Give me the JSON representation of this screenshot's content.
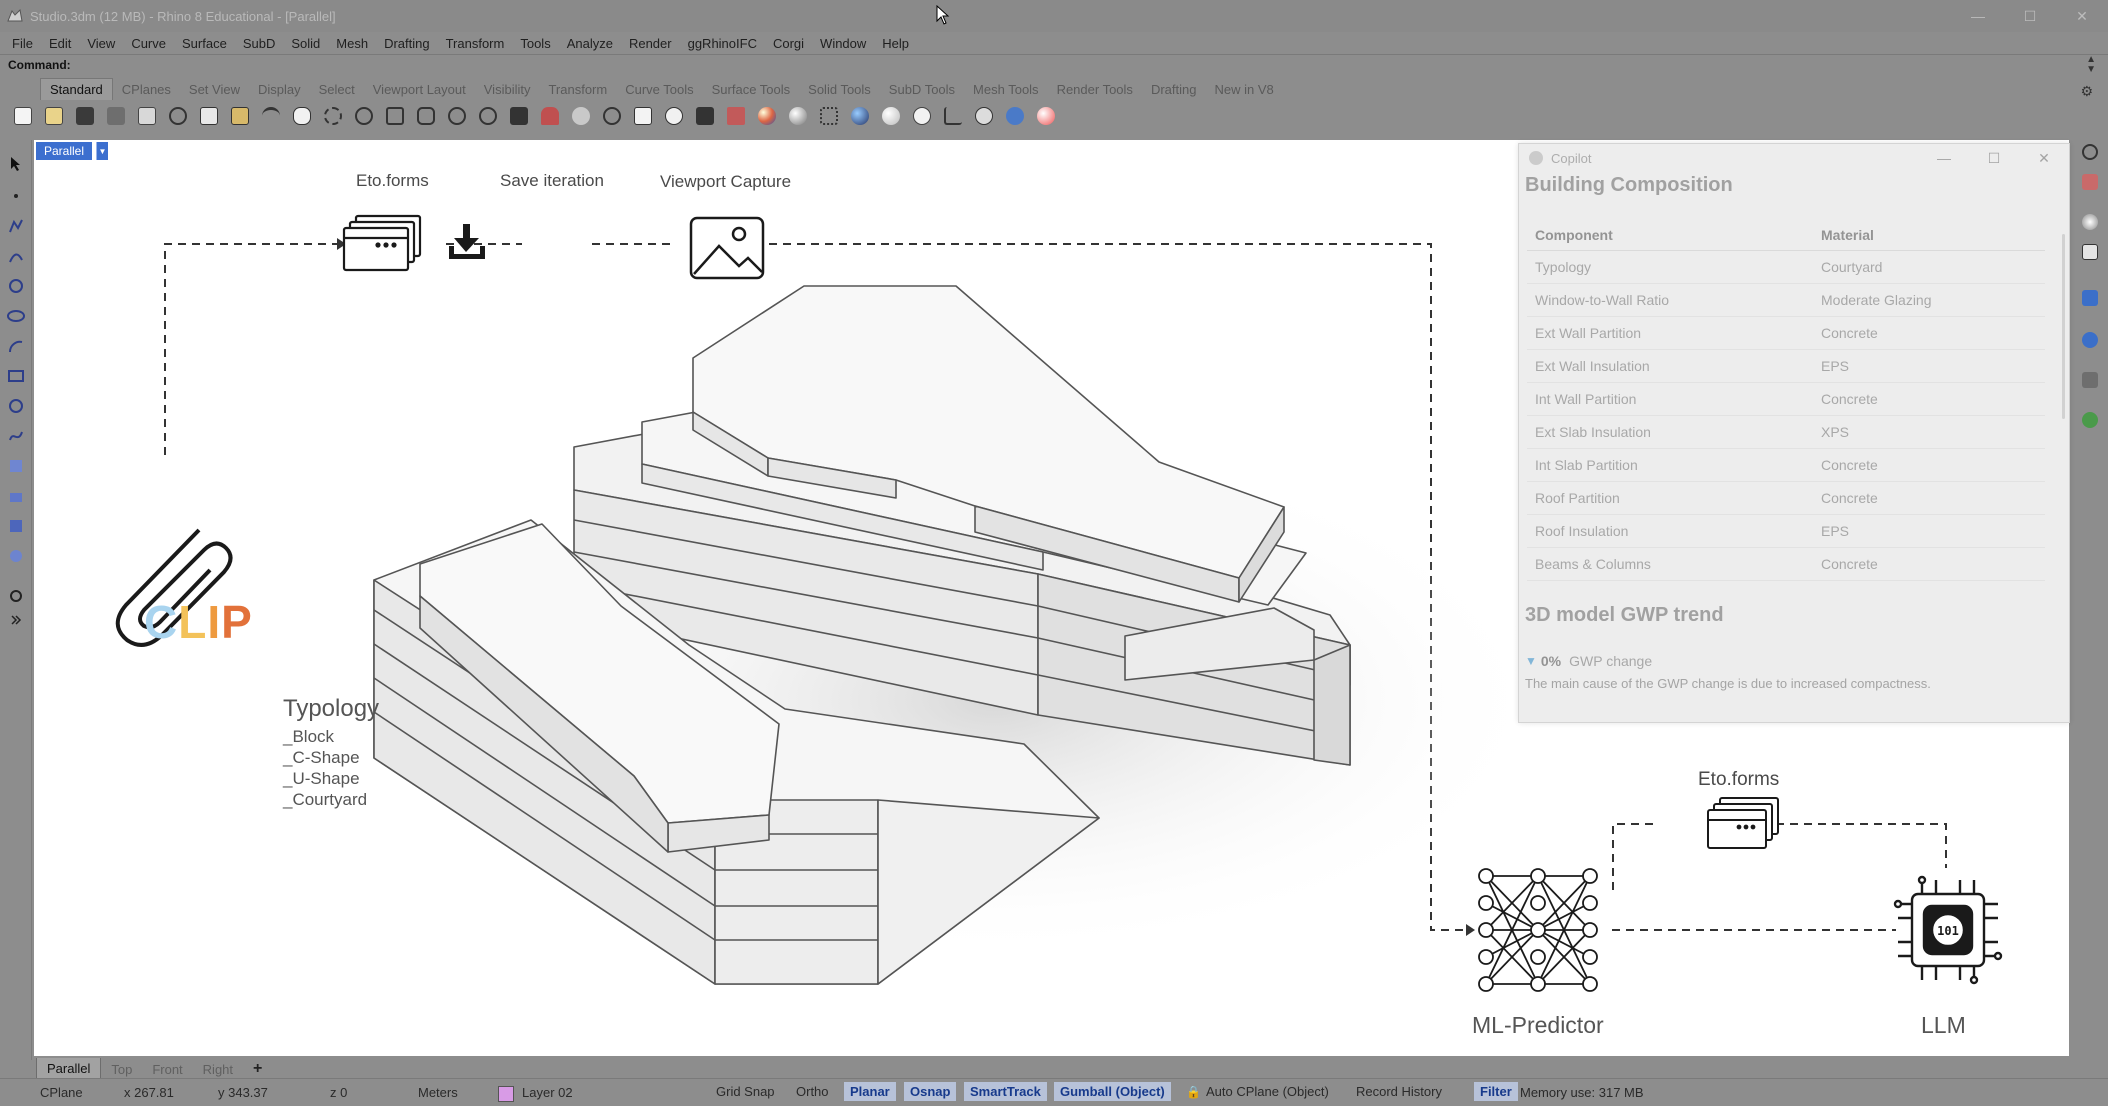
{
  "window": {
    "title": "Studio.3dm (12 MB) - Rhino 8 Educational - [Parallel]",
    "controls": [
      "—",
      "☐",
      "✕"
    ]
  },
  "menu": [
    "File",
    "Edit",
    "View",
    "Curve",
    "Surface",
    "SubD",
    "Solid",
    "Mesh",
    "Drafting",
    "Transform",
    "Tools",
    "Analyze",
    "Render",
    "ggRhinoIFC",
    "Corgi",
    "Window",
    "Help"
  ],
  "command": {
    "label": "Command:"
  },
  "toolbar_tabs": [
    "Standard",
    "CPlanes",
    "Set View",
    "Display",
    "Select",
    "Viewport Layout",
    "Visibility",
    "Transform",
    "Curve Tools",
    "Surface Tools",
    "Solid Tools",
    "SubD Tools",
    "Mesh Tools",
    "Render Tools",
    "Drafting",
    "New in V8"
  ],
  "active_toolbar_tab": "Standard",
  "viewport": {
    "name": "Parallel",
    "labels": {
      "etoforms_top": "Eto.forms",
      "save_iteration": "Save iteration",
      "viewport_capture": "Viewport Capture",
      "etoforms_bottom": "Eto.forms",
      "ml_predictor": "ML-Predictor",
      "llm": "LLM"
    },
    "clip": {
      "letters": [
        "C",
        "L",
        "I",
        "P"
      ],
      "colors": [
        "#a9d4ef",
        "#f3c25a",
        "#ee9a3f",
        "#e2713a"
      ]
    },
    "typology": {
      "title": "Typology",
      "items": [
        "_Block",
        "_C-Shape",
        "_U-Shape",
        "_Courtyard"
      ]
    }
  },
  "copilot": {
    "title": "Copilot",
    "controls": [
      "—",
      "☐",
      "✕"
    ],
    "heading": "Building Composition",
    "table": {
      "headers": [
        "Component",
        "Material"
      ],
      "rows": [
        [
          "Typology",
          "Courtyard"
        ],
        [
          "Window-to-Wall Ratio",
          "Moderate Glazing"
        ],
        [
          "Ext Wall Partition",
          "Concrete"
        ],
        [
          "Ext Wall Insulation",
          "EPS"
        ],
        [
          "Int Wall Partition",
          "Concrete"
        ],
        [
          "Ext Slab Insulation",
          "XPS"
        ],
        [
          "Int Slab Partition",
          "Concrete"
        ],
        [
          "Roof Partition",
          "Concrete"
        ],
        [
          "Roof Insulation",
          "EPS"
        ],
        [
          "Beams & Columns",
          "Concrete"
        ]
      ]
    },
    "trend_heading": "3D model GWP trend",
    "trend_value": "0%",
    "trend_label": "GWP change",
    "trend_note": "The main cause of the GWP change is due to increased compactness."
  },
  "viewport_tabs": [
    "Parallel",
    "Top",
    "Front",
    "Right",
    "+"
  ],
  "status": {
    "cplane": "CPlane",
    "x": "x 267.81",
    "y": "y 343.37",
    "z": "z 0",
    "units": "Meters",
    "layer": "Layer 02",
    "layer_color": "#d89be6",
    "grid_snap": "Grid Snap",
    "ortho": "Ortho",
    "planar": "Planar",
    "osnap": "Osnap",
    "smarttrack": "SmartTrack",
    "gumball": "Gumball (Object)",
    "auto_cplane": "Auto CPlane (Object)",
    "record_history": "Record History",
    "filter": "Filter",
    "memory": "Memory use: 317 MB"
  }
}
